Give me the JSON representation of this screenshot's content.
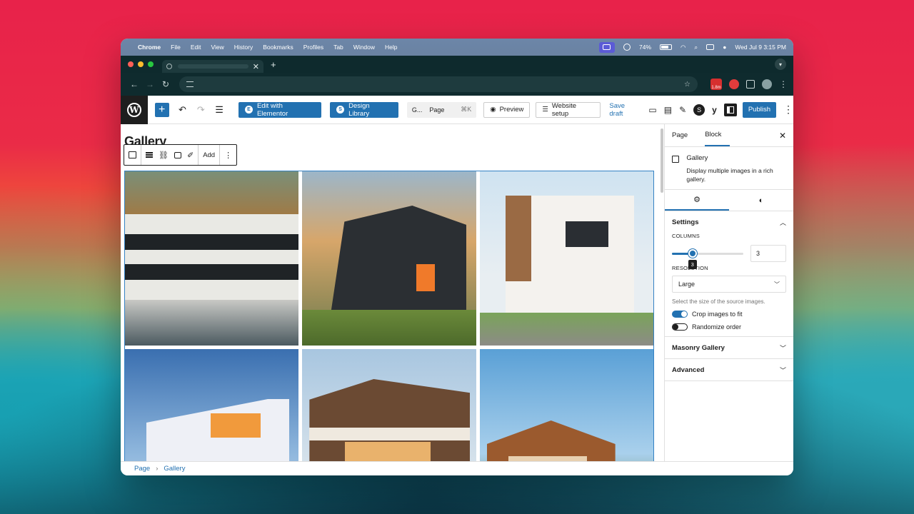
{
  "menubar": {
    "app": "Chrome",
    "items": [
      "File",
      "Edit",
      "View",
      "History",
      "Bookmarks",
      "Profiles",
      "Tab",
      "Window",
      "Help"
    ],
    "battery": "74%",
    "clock": "Wed Jul 9  3:15 PM"
  },
  "browser": {
    "tab_close": "✕",
    "new_tab": "+",
    "url": "",
    "ext_badge": "1.8m",
    "traffic_light_colors": [
      "#ff5f57",
      "#febc2e",
      "#28c840"
    ]
  },
  "editor": {
    "toolbar": {
      "edit_elementor": "Edit with Elementor",
      "design_library": "Design Library",
      "command_text": "G...",
      "command_type": "Page",
      "command_shortcut": "⌘K",
      "preview": "Preview",
      "website_setup": "Website setup",
      "save_draft": "Save draft",
      "publish": "Publish"
    },
    "page_title": "Gallery",
    "block_toolbar": {
      "add": "Add"
    },
    "gallery_images": [
      "Modern lakeside villa",
      "Dark house with solar panels",
      "White modern villa with palms",
      "Cantilevered modern house at dusk",
      "Two-storey timber villa",
      "Wooden house among pines"
    ],
    "breadcrumb": [
      "Page",
      "Gallery"
    ]
  },
  "sidebar": {
    "tabs": [
      "Page",
      "Block"
    ],
    "active_tab": "Block",
    "block_name": "Gallery",
    "block_description": "Display multiple images in a rich gallery.",
    "settings_panel": {
      "title": "Settings",
      "columns_label": "COLUMNS",
      "columns_value": "3",
      "columns_min": 1,
      "columns_max": 8,
      "resolution_label": "RESOLUTION",
      "resolution_value": "Large",
      "resolution_help": "Select the size of the source images.",
      "crop_label": "Crop images to fit",
      "crop_on": true,
      "randomize_label": "Randomize order",
      "randomize_on": false
    },
    "masonry_panel": "Masonry Gallery",
    "advanced_panel": "Advanced"
  },
  "colors": {
    "accent": "#2271b1",
    "wp_dark": "#1e1e1e"
  }
}
